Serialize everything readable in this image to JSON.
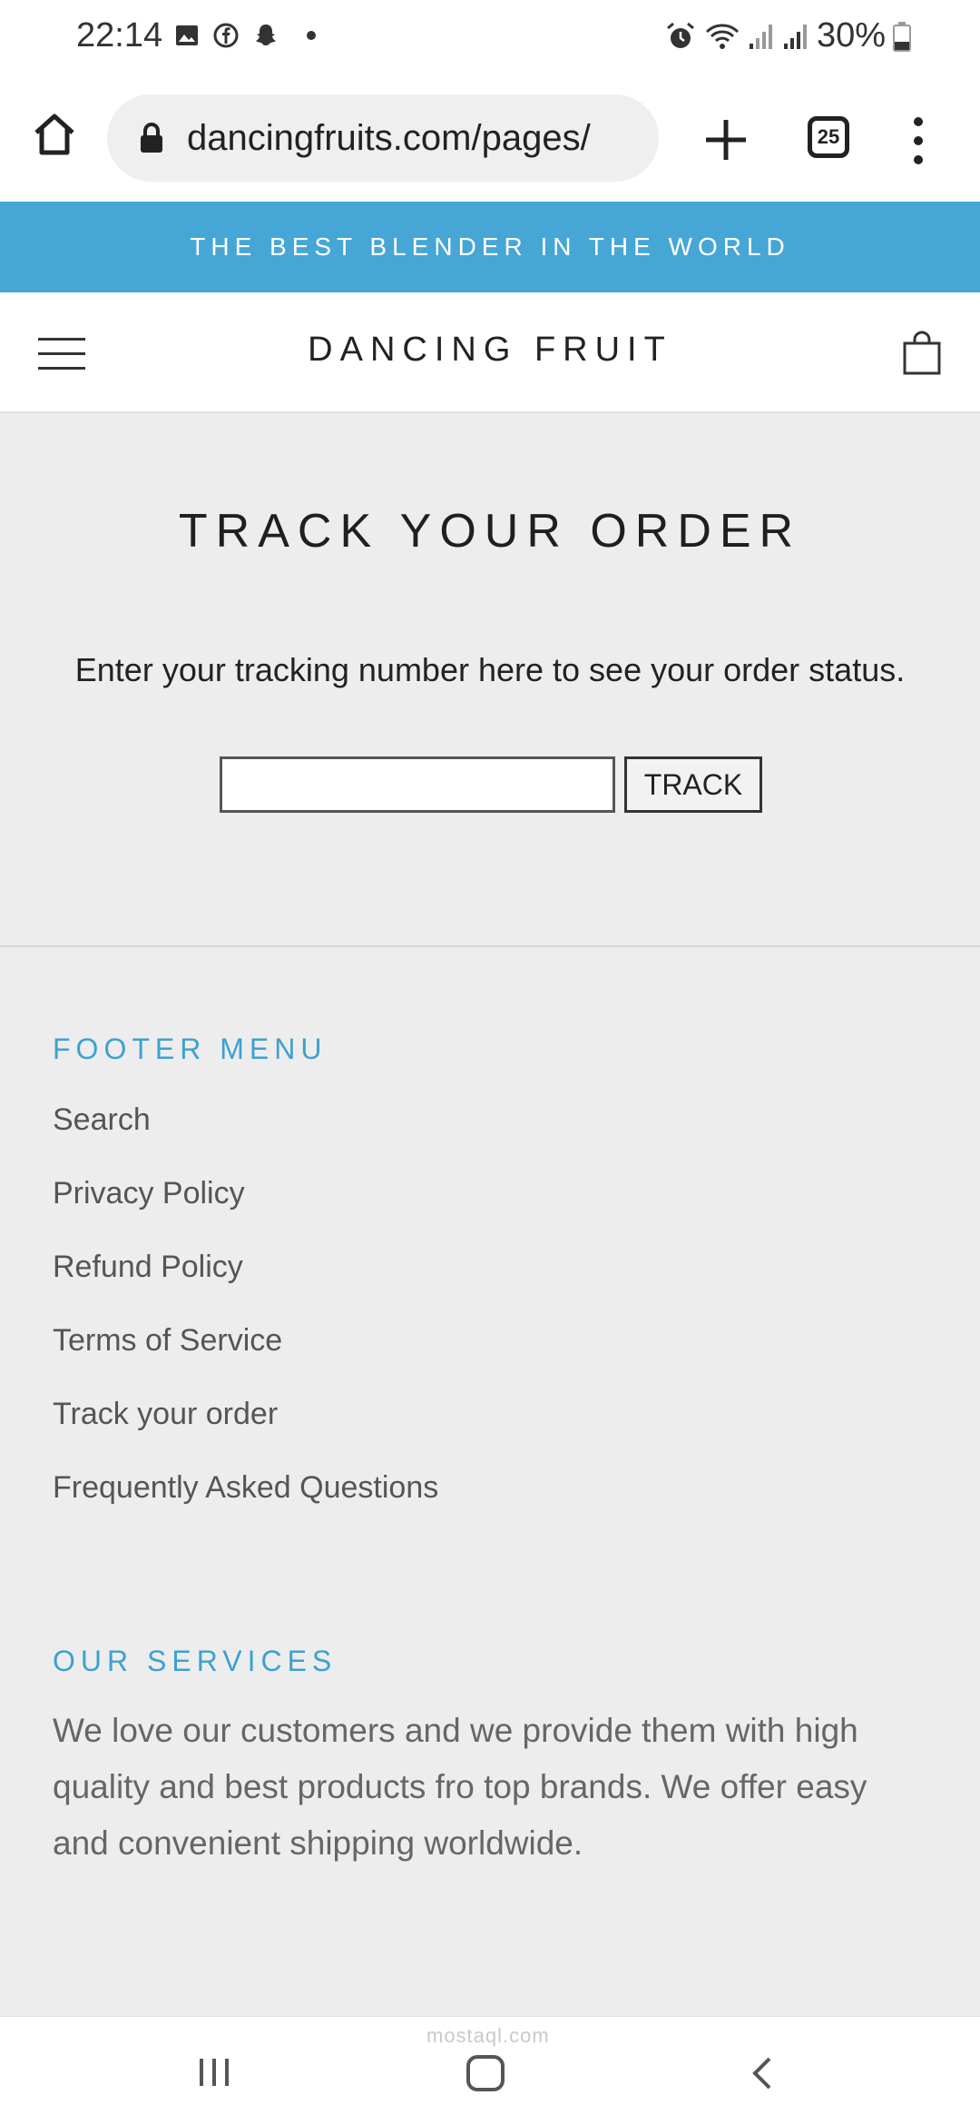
{
  "status_bar": {
    "time": "22:14",
    "battery": "30%",
    "left_icons": [
      "gallery-icon",
      "facebook-icon",
      "snapchat-icon",
      "notification-dot"
    ],
    "right_icons": [
      "alarm-icon",
      "wifi-icon",
      "signal-icon",
      "signal-icon",
      "battery-icon"
    ]
  },
  "browser": {
    "url": "dancingfruits.com/pages/",
    "tab_count": "25"
  },
  "announcement": {
    "text": "THE BEST BLENDER IN THE WORLD",
    "background": "#46a6d6"
  },
  "header": {
    "brand": "DANCING FRUIT"
  },
  "main": {
    "title": "TRACK YOUR ORDER",
    "instruction": "Enter your tracking number here to see your order status.",
    "input_value": "",
    "track_label": "TRACK"
  },
  "footer": {
    "menu_heading": "FOOTER MENU",
    "links": [
      "Search",
      "Privacy Policy",
      "Refund Policy",
      "Terms of Service",
      "Track your order",
      "Frequently Asked Questions"
    ],
    "services_heading": "OUR SERVICES",
    "services_text": "We love our customers and we provide them with high quality and best products fro top brands. We offer easy and convenient shipping worldwide.",
    "heading_color": "#3ea1cf"
  },
  "watermark": "mostaql.com"
}
